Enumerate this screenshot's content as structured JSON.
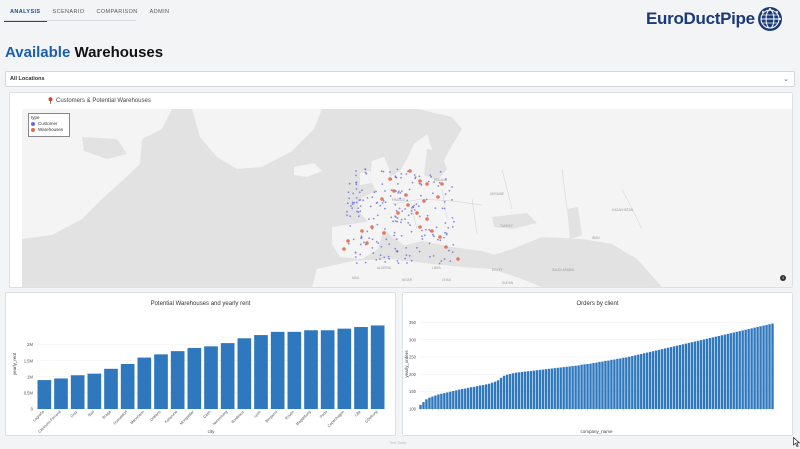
{
  "nav": {
    "tabs": [
      {
        "label": "ANALYSIS",
        "active": true
      },
      {
        "label": "SCENARIO",
        "active": false
      },
      {
        "label": "COMPARISON",
        "active": false
      },
      {
        "label": "ADMIN",
        "active": false
      }
    ]
  },
  "brand": {
    "name": "EuroDuctPipe",
    "color": "#1b3b78"
  },
  "page": {
    "title_accent": "Available",
    "title_rest": " Warehouses"
  },
  "filter": {
    "selected": "All Locations"
  },
  "map": {
    "title": "Customers & Potential Warehouses",
    "legend_title": "type",
    "legend_items": [
      {
        "label": "Customer",
        "color": "#6b6fd6"
      },
      {
        "label": "Warehouses",
        "color": "#e36a4c"
      }
    ],
    "country_labels": [
      "FRANCE",
      "POLAND",
      "UKRAINE",
      "KAZAKHSTAN",
      "TURKEY",
      "LIBYA",
      "EGYPT",
      "ALGERIA",
      "MALI",
      "NIGER",
      "SUDAN",
      "CHAD",
      "IRAN",
      "SAUDI ARABIA"
    ]
  },
  "footer": {
    "note": "Test Data"
  },
  "chart_data": [
    {
      "type": "bar",
      "title": "Potential Warehouses and yearly rent",
      "xlabel": "city",
      "ylabel": "yearly_rent",
      "color": "#2f78bd",
      "categories": [
        "Logroño",
        "Clermont-Ferrand",
        "Graz",
        "Bari",
        "Braga",
        "Dusseldorf",
        "Mannheim",
        "Orléans",
        "Karlsruhe",
        "Montpellier",
        "Caen",
        "Nuremberg",
        "Bordeaux",
        "Lyon",
        "Bergamo",
        "Rouen",
        "Magdeburg",
        "Porto",
        "Copenhagen",
        "Lille",
        "Göteborg"
      ],
      "values": [
        0.9,
        0.95,
        1.05,
        1.1,
        1.25,
        1.4,
        1.6,
        1.7,
        1.8,
        1.9,
        1.95,
        2.05,
        2.2,
        2.3,
        2.4,
        2.4,
        2.45,
        2.45,
        2.5,
        2.55,
        2.6
      ],
      "yticks": [
        "0",
        "0.5M",
        "1M",
        "1.5M",
        "2M"
      ],
      "ylim": [
        0,
        2.8
      ]
    },
    {
      "type": "bar",
      "title": "Orders by client",
      "xlabel": "company_name",
      "ylabel": "yearly_orders",
      "color": "#2f78bd",
      "yticks": [
        "100",
        "150",
        "200",
        "250",
        "300",
        "350"
      ],
      "ylim": [
        100,
        360
      ],
      "values": [
        112,
        120,
        128,
        133,
        136,
        139,
        142,
        144,
        146,
        148,
        150,
        152,
        154,
        156,
        158,
        159,
        161,
        163,
        164,
        166,
        168,
        169,
        171,
        173,
        176,
        179,
        183,
        190,
        196,
        199,
        201,
        203,
        205,
        206,
        207,
        208,
        209,
        210,
        211,
        212,
        213,
        214,
        215,
        216,
        217,
        218,
        219,
        220,
        221,
        222,
        223,
        224,
        225,
        226,
        228,
        229,
        230,
        231,
        233,
        234,
        236,
        237,
        239,
        240,
        242,
        243,
        245,
        246,
        248,
        249,
        251,
        253,
        255,
        257,
        259,
        261,
        263,
        265,
        267,
        269,
        271,
        273,
        275,
        277,
        279,
        281,
        283,
        285,
        287,
        289,
        291,
        293,
        295,
        297,
        299,
        301,
        303,
        305,
        307,
        309,
        311,
        313,
        315,
        317,
        319,
        321,
        323,
        325,
        327,
        329,
        331,
        333,
        335,
        337,
        339,
        341,
        343,
        345,
        347
      ]
    }
  ]
}
